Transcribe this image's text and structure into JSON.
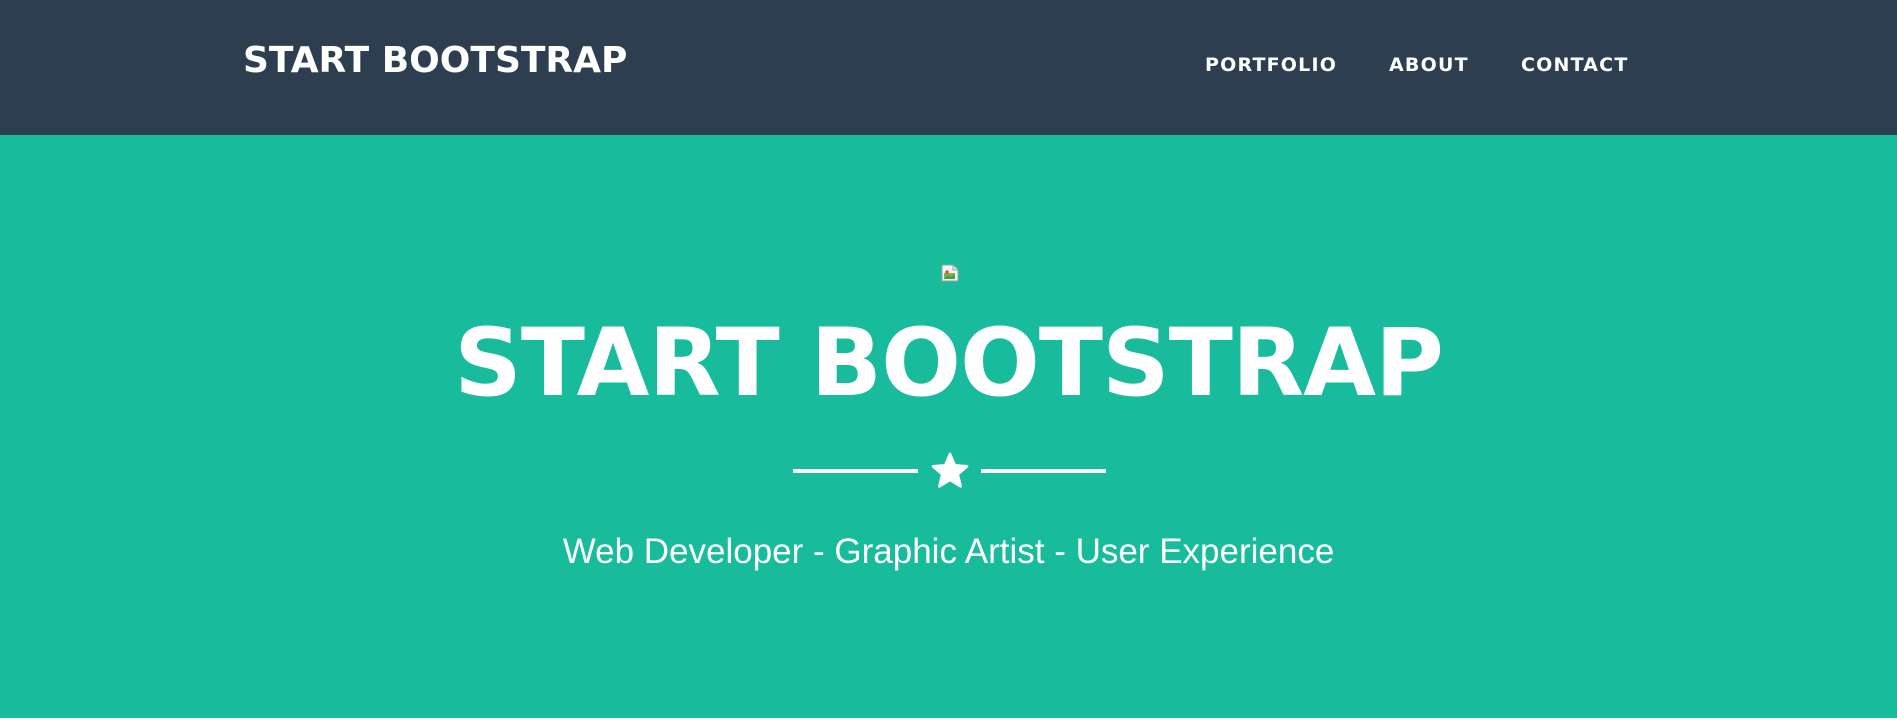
{
  "navbar": {
    "brand": "START BOOTSTRAP",
    "links": [
      "PORTFOLIO",
      "ABOUT",
      "CONTACT"
    ]
  },
  "hero": {
    "title": "START BOOTSTRAP",
    "subtitle": "Web Developer - Graphic Artist - User Experience",
    "divider_icon": "star-icon",
    "image_icon": "broken-image-icon"
  },
  "colors": {
    "navbar_bg": "#2c3e50",
    "hero_bg": "#18bc9c",
    "text": "#ffffff"
  }
}
